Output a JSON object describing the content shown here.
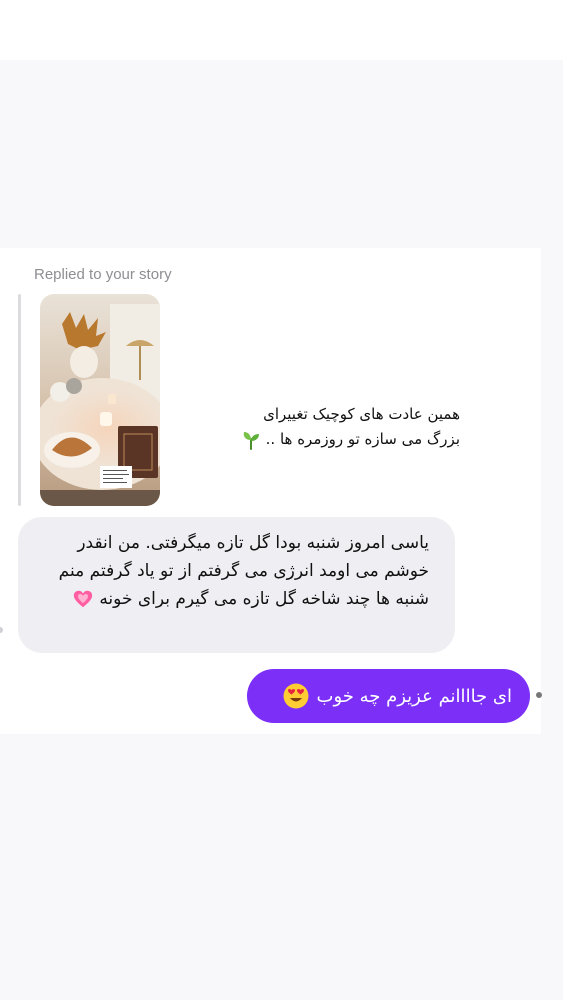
{
  "story_reply": {
    "label": "Replied to your story",
    "caption_line1": "همین عادت های کوچیک تغییرای",
    "caption_line2": "بزرگ می سازه تو روزمره ها ..",
    "caption_icon": "sprout-icon"
  },
  "incoming_message": {
    "text": "یاسی امروز شنبه بودا گل تازه میگرفتی. من انقدر خوشم می اومد انرژی می گرفتم از تو یاد گرفتم منم شنبه ها چند شاخه گل تازه می گیرم برای خونه",
    "emoji": "growing-heart-icon"
  },
  "outgoing_message": {
    "text": "ای جاااانم عزیزم  چه خوب",
    "emoji": "heart-eyes-icon"
  },
  "colors": {
    "outgoing_bubble": "#7b2ff7",
    "incoming_bubble": "#efeff3",
    "label_gray": "#8e8e93"
  }
}
